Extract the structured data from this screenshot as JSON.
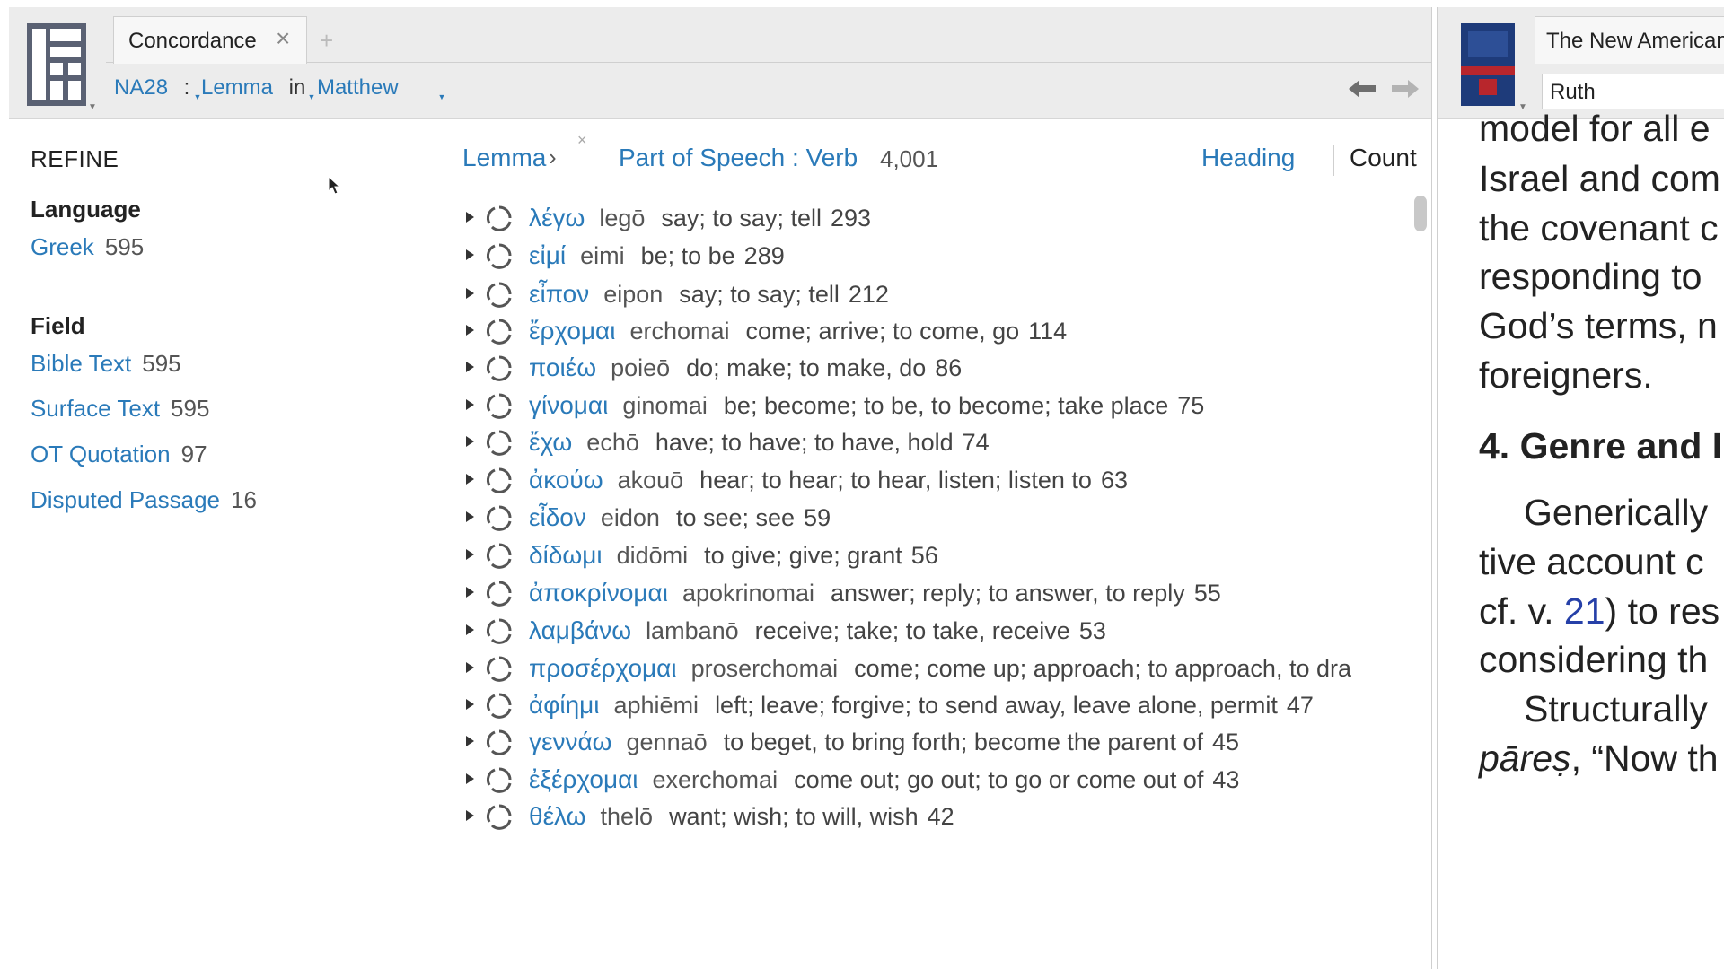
{
  "concordance": {
    "tab_title": "Concordance",
    "tab_close": "×",
    "new_tab": "+",
    "path": {
      "resource": "NA28",
      "sep1": ":",
      "type": "Lemma",
      "sep2": "in",
      "range": "Matthew"
    },
    "refine": {
      "title": "REFINE",
      "language_heading": "Language",
      "language_items": [
        {
          "label": "Greek",
          "count": "595"
        }
      ],
      "field_heading": "Field",
      "field_items": [
        {
          "label": "Bible Text",
          "count": "595"
        },
        {
          "label": "Surface Text",
          "count": "595"
        },
        {
          "label": "OT Quotation",
          "count": "97"
        },
        {
          "label": "Disputed Passage",
          "count": "16"
        }
      ]
    },
    "results_header": {
      "crumb_lemma": "Lemma",
      "crumb_arrow": "›",
      "crumb_remove": "×",
      "crumb_filter": "Part of Speech : Verb",
      "total_count": "4,001",
      "heading_button": "Heading",
      "count_button": "Count"
    },
    "rows": [
      {
        "greek": "λέγω",
        "translit": "legō",
        "gloss": "say; to say; tell",
        "count": "293"
      },
      {
        "greek": "εἰμί",
        "translit": "eimi",
        "gloss": "be; to be",
        "count": "289"
      },
      {
        "greek": "εἶπον",
        "translit": "eipon",
        "gloss": "say; to say; tell",
        "count": "212"
      },
      {
        "greek": "ἔρχομαι",
        "translit": "erchomai",
        "gloss": "come; arrive; to come, go",
        "count": "114"
      },
      {
        "greek": "ποιέω",
        "translit": "poieō",
        "gloss": "do; make; to make, do",
        "count": "86"
      },
      {
        "greek": "γίνομαι",
        "translit": "ginomai",
        "gloss": "be; become; to be, to become; take place",
        "count": "75"
      },
      {
        "greek": "ἔχω",
        "translit": "echō",
        "gloss": "have; to have; to have, hold",
        "count": "74"
      },
      {
        "greek": "ἀκούω",
        "translit": "akouō",
        "gloss": "hear; to hear; to hear, listen; listen to",
        "count": "63"
      },
      {
        "greek": "εἶδον",
        "translit": "eidon",
        "gloss": "to see; see",
        "count": "59"
      },
      {
        "greek": "δίδωμι",
        "translit": "didōmi",
        "gloss": "to give; give; grant",
        "count": "56"
      },
      {
        "greek": "ἀποκρίνομαι",
        "translit": "apokrinomai",
        "gloss": "answer; reply; to answer, to reply",
        "count": "55"
      },
      {
        "greek": "λαμβάνω",
        "translit": "lambanō",
        "gloss": "receive; take; to take, receive",
        "count": "53"
      },
      {
        "greek": "προσέρχομαι",
        "translit": "proserchomai",
        "gloss": "come; come up; approach; to approach, to dra",
        "count": ""
      },
      {
        "greek": "ἀφίημι",
        "translit": "aphiēmi",
        "gloss": "left; leave; forgive; to send away, leave alone, permit",
        "count": "47"
      },
      {
        "greek": "γεννάω",
        "translit": "gennaō",
        "gloss": "to beget, to bring forth; become the parent of",
        "count": "45"
      },
      {
        "greek": "ἐξέρχομαι",
        "translit": "exerchomai",
        "gloss": "come out; go out; to go or come out of",
        "count": "43"
      },
      {
        "greek": "θέλω",
        "translit": "thelō",
        "gloss": "want; wish; to will, wish",
        "count": "42"
      }
    ]
  },
  "commentary": {
    "tab_title": "The New American",
    "reference": "Ruth",
    "lines": [
      {
        "text": "model for all e",
        "style": "normal"
      },
      {
        "text": "Israel and com",
        "style": "normal"
      },
      {
        "text": "the covenant c",
        "style": "normal"
      },
      {
        "text": "responding to",
        "style": "normal"
      },
      {
        "text": "God’s terms, n",
        "style": "normal"
      },
      {
        "text": "foreigners.",
        "style": "normal"
      },
      {
        "text": "4. Genre and I",
        "style": "bold"
      },
      {
        "text": "Generically",
        "style": "indent"
      },
      {
        "text": "tive account c",
        "style": "normal"
      },
      {
        "pre": "cf. v. ",
        "ref": "21",
        "post": ") to res",
        "style": "ref"
      },
      {
        "text": "considering th",
        "style": "normal"
      },
      {
        "text": "Structurally",
        "style": "indent"
      },
      {
        "ital": "pāreṣ",
        "post": ", “Now th",
        "style": "ital"
      }
    ]
  },
  "colors": {
    "link": "#2a7ab9",
    "header_bg": "#ececec",
    "verse_ref": "#2640a8"
  },
  "icons": {
    "app_menu": "layout-grid-icon",
    "back": "arrow-left-icon",
    "forward": "arrow-right-icon",
    "row_expand": "triangle-right-icon",
    "row_status": "refresh-circle-icon",
    "cover": "book-cover-icon"
  }
}
